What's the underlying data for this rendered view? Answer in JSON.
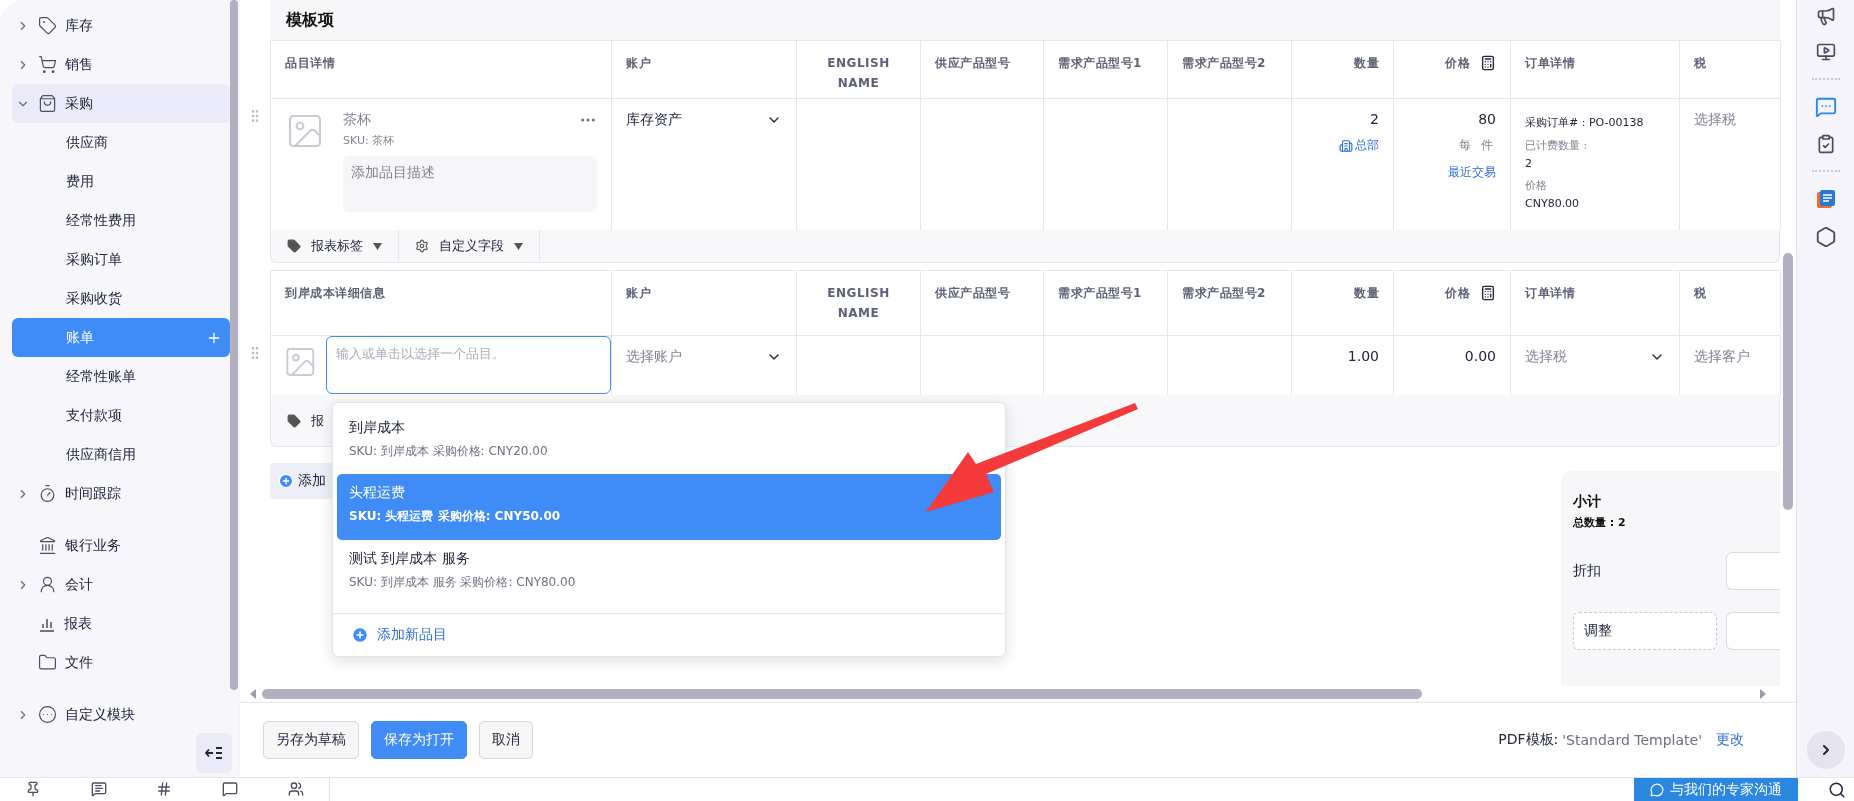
{
  "sidebar": {
    "items": [
      {
        "label": "库存",
        "kind": "group",
        "expanded": false,
        "selected": false
      },
      {
        "label": "销售",
        "kind": "group",
        "expanded": false,
        "selected": false
      },
      {
        "label": "采购",
        "kind": "group",
        "expanded": true,
        "selected": false,
        "children": [
          {
            "label": "供应商",
            "selected": false
          },
          {
            "label": "费用",
            "selected": false
          },
          {
            "label": "经常性费用",
            "selected": false
          },
          {
            "label": "采购订单",
            "selected": false
          },
          {
            "label": "采购收货",
            "selected": false
          },
          {
            "label": "账单",
            "selected": true
          },
          {
            "label": "经常性账单",
            "selected": false
          },
          {
            "label": "支付款项",
            "selected": false
          },
          {
            "label": "供应商信用",
            "selected": false
          }
        ]
      },
      {
        "label": "时间跟踪",
        "kind": "group",
        "expanded": false,
        "selected": false
      },
      {
        "label": "银行业务",
        "kind": "link",
        "selected": false
      },
      {
        "label": "会计",
        "kind": "group",
        "expanded": false,
        "selected": false
      },
      {
        "label": "报表",
        "kind": "link",
        "selected": false
      },
      {
        "label": "文件",
        "kind": "link",
        "selected": false
      },
      {
        "label": "自定义模块",
        "kind": "group",
        "expanded": false,
        "selected": false
      }
    ]
  },
  "section_title": "模板项",
  "item_table": {
    "columns": [
      "品目详情",
      "账户",
      "ENGLISH NAME",
      "供应产品型号",
      "需求产品型号1",
      "需求产品型号2",
      "数量",
      "价格",
      "订单详情",
      "税"
    ],
    "row": {
      "name": "茶杯",
      "sku": "SKU: 茶杯",
      "description_placeholder": "添加品目描述",
      "account": "库存资产",
      "quantity": "2",
      "location": "总部",
      "price": "80",
      "unit": "每 件",
      "recent_link": "最近交易",
      "order_details": [
        {
          "kind": "value",
          "text": "采购订单# : PO-00138"
        },
        {
          "kind": "label",
          "text": "已计费数量 :"
        },
        {
          "kind": "value",
          "text": "2"
        },
        {
          "kind": "label",
          "text": "价格"
        },
        {
          "kind": "value",
          "text": "CNY80.00"
        }
      ],
      "tax": "选择税"
    },
    "tag_bar": [
      "报表标签",
      "自定义字段"
    ]
  },
  "landed_table": {
    "columns": [
      "到岸成本详细信息",
      "账户",
      "ENGLISH NAME",
      "供应产品型号",
      "需求产品型号1",
      "需求产品型号2",
      "数量",
      "价格",
      "订单详情",
      "税"
    ],
    "row": {
      "item_placeholder": "输入或单击以选择一个品目。",
      "account_placeholder": "选择账户",
      "quantity": "1.00",
      "price": "0.00",
      "tax_placeholder": "选择税",
      "customer_placeholder": "选择客户"
    },
    "tag_bar_text": "报"
  },
  "add_row_button": "添加",
  "dropdown": {
    "options": [
      {
        "name": "到岸成本",
        "detail": "SKU: 到岸成本 采购价格: CNY20.00",
        "selected": false
      },
      {
        "name": "头程运费",
        "detail": "SKU: 头程运费 采购价格: CNY50.00",
        "selected": true
      },
      {
        "name": "测试 到岸成本 服务",
        "detail": "SKU: 到岸成本 服务 采购价格: CNY80.00",
        "selected": false
      }
    ],
    "add_new": "添加新品目"
  },
  "summary": {
    "title": "小计",
    "total_quantity": "总数量 : 2",
    "discount_label": "折扣",
    "adjustment": "调整"
  },
  "footer": {
    "buttons": [
      {
        "label": "另存为草稿",
        "primary": false
      },
      {
        "label": "保存为打开",
        "primary": true
      },
      {
        "label": "取消",
        "primary": false
      }
    ],
    "pdf_label": "PDF模板:",
    "pdf_template": "'Standard Template'",
    "change_link": "更改"
  },
  "chat_button": "与我们的专家沟通"
}
